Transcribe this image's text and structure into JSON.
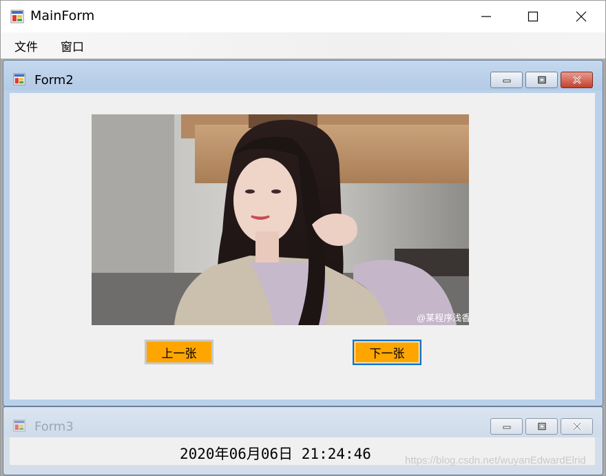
{
  "main_window": {
    "title": "MainForm",
    "icon": "winforms-app-icon",
    "controls": {
      "minimize": "minimize-icon",
      "maximize": "maximize-icon",
      "close": "close-icon"
    }
  },
  "menu": {
    "items": [
      {
        "label": "文件"
      },
      {
        "label": "窗口"
      }
    ]
  },
  "form2": {
    "title": "Form2",
    "icon": "winforms-app-icon",
    "image": {
      "alt": "photo-of-woman",
      "overlay_text": "@某程序浅香"
    },
    "prev_button": "上一张",
    "next_button": "下一张",
    "colors": {
      "button_bg": "#ffa500",
      "focus_border": "#0a74d8"
    }
  },
  "form3": {
    "title": "Form3",
    "icon": "winforms-app-icon",
    "time_label": "2020年06月06日 21:24:46"
  },
  "watermark": "https://blog.csdn.net/wuyanEdwardElrid"
}
